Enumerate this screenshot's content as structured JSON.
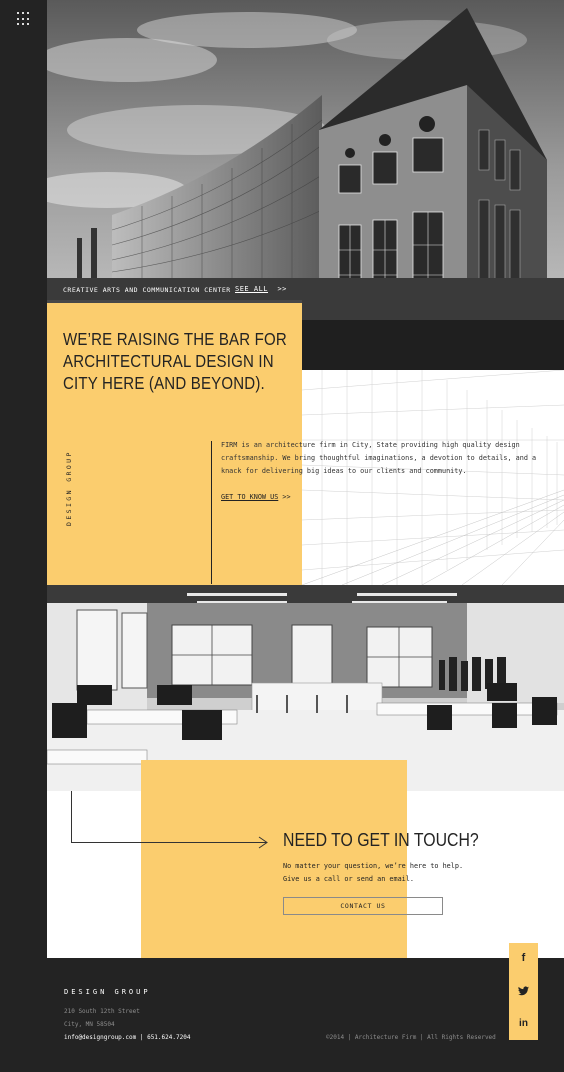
{
  "nav": {
    "menu_icon": "grid-menu-icon"
  },
  "hero": {
    "caption": "CREATIVE ARTS AND COMMUNICATION CENTER",
    "see_all": "SEE ALL",
    "see_all_arrow": ">>"
  },
  "intro": {
    "headline": "WE’RE RAISING THE BAR FOR ARCHITECTURAL DESIGN IN CITY HERE (AND BEYOND).",
    "vertical_label": "DESIGN GROUP",
    "body": "FIRM is an architecture firm in City, State providing high quality design craftsmanship. We bring thoughtful imaginations, a devotion to details, and a knack for delivering big ideas to our clients and community.",
    "link": "GET TO KNOW US",
    "link_arrow": ">>"
  },
  "contact": {
    "title": "NEED TO GET IN TOUCH?",
    "line1": "No matter your question, we’re here to help.",
    "line2": "Give us a call or send an email.",
    "button": "CONTACT US"
  },
  "footer": {
    "brand": "DESIGN GROUP",
    "address1": "210 South 12th Street",
    "address2": "City, MN 58504",
    "contact": "info@designgroup.com | 651.624.7204",
    "copyright": "©2014 | Architecture Firm | All Rights Reserved"
  },
  "social": [
    {
      "icon": "facebook-icon",
      "glyph": "f"
    },
    {
      "icon": "twitter-icon",
      "glyph": "🐦"
    },
    {
      "icon": "linkedin-icon",
      "glyph": "in"
    }
  ],
  "colors": {
    "accent": "#fbcd6e",
    "dark": "#232323"
  }
}
